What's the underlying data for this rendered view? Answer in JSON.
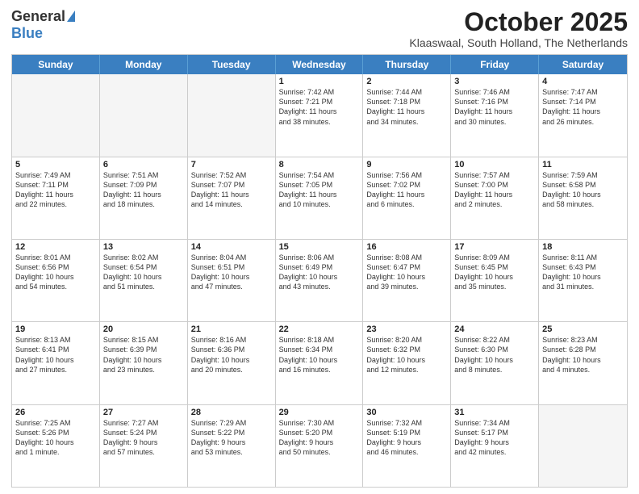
{
  "header": {
    "logo_general": "General",
    "logo_blue": "Blue",
    "month_title": "October 2025",
    "location": "Klaaswaal, South Holland, The Netherlands"
  },
  "days_of_week": [
    "Sunday",
    "Monday",
    "Tuesday",
    "Wednesday",
    "Thursday",
    "Friday",
    "Saturday"
  ],
  "weeks": [
    [
      {
        "day": "",
        "info": ""
      },
      {
        "day": "",
        "info": ""
      },
      {
        "day": "",
        "info": ""
      },
      {
        "day": "1",
        "info": "Sunrise: 7:42 AM\nSunset: 7:21 PM\nDaylight: 11 hours\nand 38 minutes."
      },
      {
        "day": "2",
        "info": "Sunrise: 7:44 AM\nSunset: 7:18 PM\nDaylight: 11 hours\nand 34 minutes."
      },
      {
        "day": "3",
        "info": "Sunrise: 7:46 AM\nSunset: 7:16 PM\nDaylight: 11 hours\nand 30 minutes."
      },
      {
        "day": "4",
        "info": "Sunrise: 7:47 AM\nSunset: 7:14 PM\nDaylight: 11 hours\nand 26 minutes."
      }
    ],
    [
      {
        "day": "5",
        "info": "Sunrise: 7:49 AM\nSunset: 7:11 PM\nDaylight: 11 hours\nand 22 minutes."
      },
      {
        "day": "6",
        "info": "Sunrise: 7:51 AM\nSunset: 7:09 PM\nDaylight: 11 hours\nand 18 minutes."
      },
      {
        "day": "7",
        "info": "Sunrise: 7:52 AM\nSunset: 7:07 PM\nDaylight: 11 hours\nand 14 minutes."
      },
      {
        "day": "8",
        "info": "Sunrise: 7:54 AM\nSunset: 7:05 PM\nDaylight: 11 hours\nand 10 minutes."
      },
      {
        "day": "9",
        "info": "Sunrise: 7:56 AM\nSunset: 7:02 PM\nDaylight: 11 hours\nand 6 minutes."
      },
      {
        "day": "10",
        "info": "Sunrise: 7:57 AM\nSunset: 7:00 PM\nDaylight: 11 hours\nand 2 minutes."
      },
      {
        "day": "11",
        "info": "Sunrise: 7:59 AM\nSunset: 6:58 PM\nDaylight: 10 hours\nand 58 minutes."
      }
    ],
    [
      {
        "day": "12",
        "info": "Sunrise: 8:01 AM\nSunset: 6:56 PM\nDaylight: 10 hours\nand 54 minutes."
      },
      {
        "day": "13",
        "info": "Sunrise: 8:02 AM\nSunset: 6:54 PM\nDaylight: 10 hours\nand 51 minutes."
      },
      {
        "day": "14",
        "info": "Sunrise: 8:04 AM\nSunset: 6:51 PM\nDaylight: 10 hours\nand 47 minutes."
      },
      {
        "day": "15",
        "info": "Sunrise: 8:06 AM\nSunset: 6:49 PM\nDaylight: 10 hours\nand 43 minutes."
      },
      {
        "day": "16",
        "info": "Sunrise: 8:08 AM\nSunset: 6:47 PM\nDaylight: 10 hours\nand 39 minutes."
      },
      {
        "day": "17",
        "info": "Sunrise: 8:09 AM\nSunset: 6:45 PM\nDaylight: 10 hours\nand 35 minutes."
      },
      {
        "day": "18",
        "info": "Sunrise: 8:11 AM\nSunset: 6:43 PM\nDaylight: 10 hours\nand 31 minutes."
      }
    ],
    [
      {
        "day": "19",
        "info": "Sunrise: 8:13 AM\nSunset: 6:41 PM\nDaylight: 10 hours\nand 27 minutes."
      },
      {
        "day": "20",
        "info": "Sunrise: 8:15 AM\nSunset: 6:39 PM\nDaylight: 10 hours\nand 23 minutes."
      },
      {
        "day": "21",
        "info": "Sunrise: 8:16 AM\nSunset: 6:36 PM\nDaylight: 10 hours\nand 20 minutes."
      },
      {
        "day": "22",
        "info": "Sunrise: 8:18 AM\nSunset: 6:34 PM\nDaylight: 10 hours\nand 16 minutes."
      },
      {
        "day": "23",
        "info": "Sunrise: 8:20 AM\nSunset: 6:32 PM\nDaylight: 10 hours\nand 12 minutes."
      },
      {
        "day": "24",
        "info": "Sunrise: 8:22 AM\nSunset: 6:30 PM\nDaylight: 10 hours\nand 8 minutes."
      },
      {
        "day": "25",
        "info": "Sunrise: 8:23 AM\nSunset: 6:28 PM\nDaylight: 10 hours\nand 4 minutes."
      }
    ],
    [
      {
        "day": "26",
        "info": "Sunrise: 7:25 AM\nSunset: 5:26 PM\nDaylight: 10 hours\nand 1 minute."
      },
      {
        "day": "27",
        "info": "Sunrise: 7:27 AM\nSunset: 5:24 PM\nDaylight: 9 hours\nand 57 minutes."
      },
      {
        "day": "28",
        "info": "Sunrise: 7:29 AM\nSunset: 5:22 PM\nDaylight: 9 hours\nand 53 minutes."
      },
      {
        "day": "29",
        "info": "Sunrise: 7:30 AM\nSunset: 5:20 PM\nDaylight: 9 hours\nand 50 minutes."
      },
      {
        "day": "30",
        "info": "Sunrise: 7:32 AM\nSunset: 5:19 PM\nDaylight: 9 hours\nand 46 minutes."
      },
      {
        "day": "31",
        "info": "Sunrise: 7:34 AM\nSunset: 5:17 PM\nDaylight: 9 hours\nand 42 minutes."
      },
      {
        "day": "",
        "info": ""
      }
    ]
  ]
}
